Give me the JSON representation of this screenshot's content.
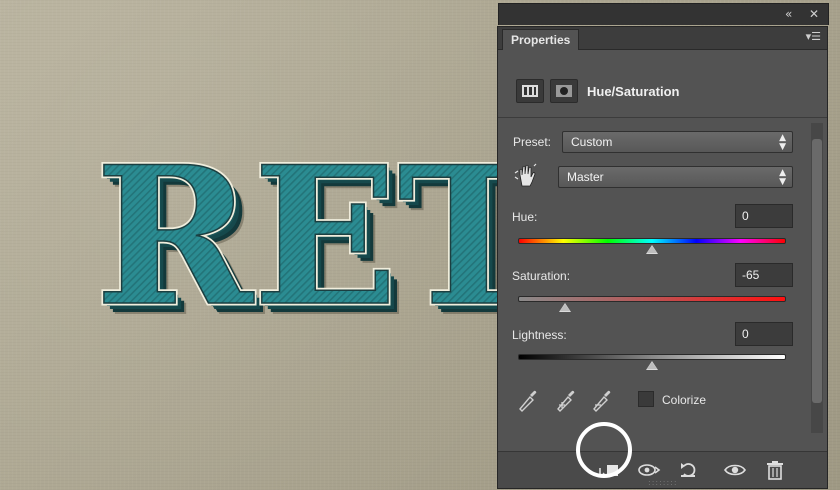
{
  "canvas": {
    "art_text": "RET"
  },
  "panel": {
    "tab_label": "Properties",
    "adjustment_title": "Hue/Saturation",
    "preset_label": "Preset:",
    "preset_value": "Custom",
    "channel_value": "Master",
    "hue_label": "Hue:",
    "hue_value": "0",
    "saturation_label": "Saturation:",
    "saturation_value": "-65",
    "lightness_label": "Lightness:",
    "lightness_value": "0",
    "colorize_label": "Colorize"
  },
  "sliders": {
    "hue_fraction": 0.5,
    "saturation_fraction": 0.175,
    "lightness_fraction": 0.5
  },
  "colors": {
    "panel_bg": "#535353",
    "letter_fill": "#2b8c92",
    "letter_shadow": "#16494c",
    "letter_outline": "#f1eedd"
  },
  "icons": {
    "collapse": "double-left-chevron-icon",
    "close": "close-icon",
    "panel_menu": "panel-menu-icon",
    "clip": "clip-to-layer-icon",
    "view_previous": "view-previous-icon",
    "reset": "reset-icon",
    "visibility": "eye-icon",
    "delete": "trash-icon"
  }
}
